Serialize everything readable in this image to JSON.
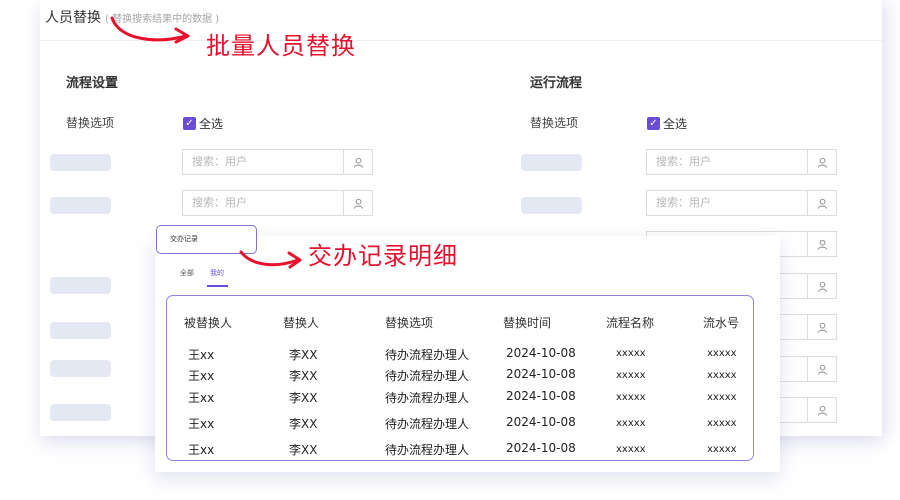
{
  "header": {
    "title": "人员替换",
    "subtitle": "( 替换搜索结果中的数据 )"
  },
  "annotations": {
    "batch_replace": "批量人员替换",
    "assign_record_detail": "交办记录明细"
  },
  "colors": {
    "accent": "#6a4dd6",
    "annotation_red": "#e8112d",
    "pill": "#e4e8f3"
  },
  "process_settings": {
    "title": "流程设置",
    "option_label": "替换选项",
    "select_all": "全选",
    "search_placeholder": "搜索：用户"
  },
  "running_process": {
    "title": "运行流程",
    "option_label": "替换选项",
    "select_all": "全选",
    "search_placeholder": "搜索：用户"
  },
  "record_panel": {
    "title": "交办记录",
    "tabs": [
      {
        "label": "全部",
        "active": false
      },
      {
        "label": "我的",
        "active": true
      }
    ],
    "columns": [
      "被替换人",
      "替换人",
      "替换选项",
      "替换时间",
      "流程名称",
      "流水号"
    ],
    "rows": [
      [
        "王xx",
        "李XX",
        "待办流程办理人",
        "2024-10-08",
        "xxxxx",
        "xxxxx"
      ],
      [
        "王xx",
        "李XX",
        "待办流程办理人",
        "2024-10-08",
        "xxxxx",
        "xxxxx"
      ],
      [
        "王xx",
        "李XX",
        "待办流程办理人",
        "2024-10-08",
        "xxxxx",
        "xxxxx"
      ],
      [
        "王xx",
        "李XX",
        "待办流程办理人",
        "2024-10-08",
        "xxxxx",
        "xxxxx"
      ],
      [
        "王xx",
        "李XX",
        "待办流程办理人",
        "2024-10-08",
        "xxxxx",
        "xxxxx"
      ]
    ]
  }
}
